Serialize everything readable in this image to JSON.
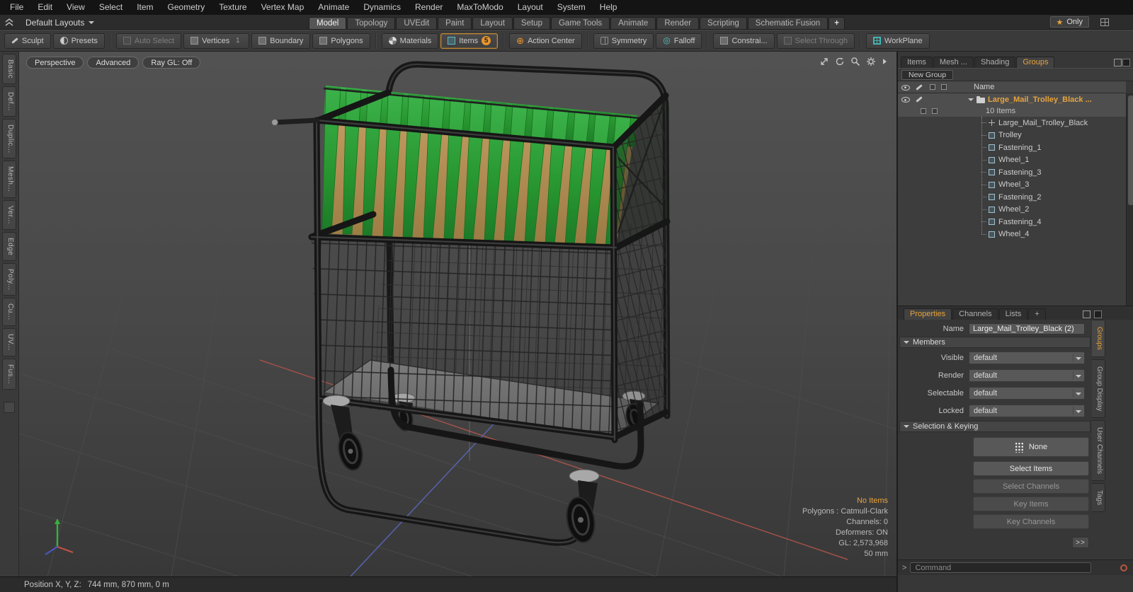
{
  "colors": {
    "accent_orange": "#e8a33d",
    "teal": "#4fc3c3",
    "folder_green": "#2f9e38",
    "folder_tan": "#c19a5e",
    "viewport_bg": "#474747"
  },
  "menubar": {
    "items": [
      "File",
      "Edit",
      "View",
      "Select",
      "Item",
      "Geometry",
      "Texture",
      "Vertex Map",
      "Animate",
      "Dynamics",
      "Render",
      "MaxToModo",
      "Layout",
      "System",
      "Help"
    ]
  },
  "layout_bar": {
    "layout_dropdown": "Default Layouts",
    "tabs": [
      "Model",
      "Topology",
      "UVEdit",
      "Paint",
      "Layout",
      "Setup",
      "Game Tools",
      "Animate",
      "Render",
      "Scripting",
      "Schematic Fusion"
    ],
    "active_tab": "Model",
    "add_tab": "+",
    "star": "★",
    "only_label": "Only"
  },
  "toolbar": {
    "sculpt": "Sculpt",
    "presets": "Presets",
    "auto_select": "Auto Select",
    "vertices": "Vertices",
    "vertices_count": "1",
    "boundary": "Boundary",
    "polygons": "Polygons",
    "materials": "Materials",
    "items": "Items",
    "items_count": "5",
    "action_center": "Action Center",
    "symmetry": "Symmetry",
    "falloff": "Falloff",
    "constraints": "Constrai...",
    "select_through": "Select Through",
    "workplane": "WorkPlane"
  },
  "left_toolbox": {
    "tabs": [
      "Basic",
      "Def...",
      "Duplic...",
      "Mesh...",
      "Ver...",
      "Edge",
      "Poly...",
      "Cu...",
      "UV...",
      "Fus..."
    ]
  },
  "viewport": {
    "style_buttons": [
      "Perspective",
      "Advanced",
      "Ray GL: Off"
    ],
    "info": {
      "no_items": "No Items",
      "polygons": "Polygons : Catmull-Clark",
      "channels": "Channels: 0",
      "deformers": "Deformers: ON",
      "gl": "GL: 2,573,968",
      "scale": "50 mm"
    }
  },
  "status_bar": {
    "label": "Position X, Y, Z:",
    "value": "744 mm, 870 mm, 0 m"
  },
  "right_panel": {
    "tabs": [
      "Items",
      "Mesh ...",
      "Shading",
      "Groups"
    ],
    "active_tab": "Groups",
    "new_group_button": "New Group",
    "tree": {
      "header": "Name",
      "root_label": "Large_Mail_Trolley_Black ...",
      "root_sub": "10 Items",
      "children": [
        "Large_Mail_Trolley_Black",
        "Trolley",
        "Fastening_1",
        "Wheel_1",
        "Fastening_3",
        "Wheel_3",
        "Fastening_2",
        "Wheel_2",
        "Fastening_4",
        "Wheel_4"
      ]
    },
    "properties": {
      "tabs": [
        "Properties",
        "Channels",
        "Lists",
        "+"
      ],
      "active_tab": "Properties",
      "name_label": "Name",
      "name_value": "Large_Mail_Trolley_Black (2)",
      "members_header": "Members",
      "member_rows": [
        {
          "label": "Visible",
          "value": "default"
        },
        {
          "label": "Render",
          "value": "default"
        },
        {
          "label": "Selectable",
          "value": "default"
        },
        {
          "label": "Locked",
          "value": "default"
        }
      ],
      "selection_header": "Selection & Keying",
      "none_button": "None",
      "select_items": "Select Items",
      "select_channels": "Select Channels",
      "key_items": "Key Items",
      "key_channels": "Key Channels",
      "more_button": ">>"
    },
    "side_tabs": [
      "Groups",
      "Group Display",
      "User Channels",
      "Tags"
    ],
    "active_side_tab": "Groups",
    "command": {
      "prompt": ">",
      "placeholder": "Command"
    }
  }
}
